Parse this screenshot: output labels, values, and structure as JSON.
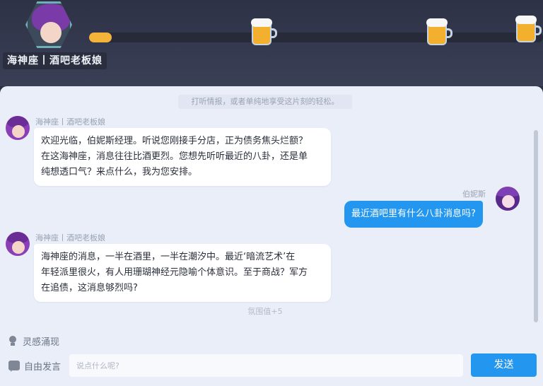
{
  "header": {
    "npc_title": "海神座丨酒吧老板娘",
    "mood_progress": 0.05,
    "beer_icons": [
      "beer-mug-icon",
      "beer-mug-icon",
      "beer-mug-icon"
    ]
  },
  "chat": {
    "hint": "打听情报，或者单纯地享受这片刻的轻松。",
    "messages": [
      {
        "sender": "海神座丨酒吧老板娘",
        "side": "left",
        "text_lines": [
          "欢迎光临，伯妮斯经理。听说您刚接手分店，正为债务焦头烂额？",
          "在这海神座，消息往往比酒更烈。您想先听听最近的八卦，还是单",
          "纯想透口气？来点什么，我为您安排。"
        ]
      },
      {
        "sender": "伯妮斯",
        "side": "right",
        "text": "最近酒吧里有什么八卦消息吗?"
      },
      {
        "sender": "海神座丨酒吧老板娘",
        "side": "left",
        "text_lines": [
          "海神座的消息，一半在酒里，一半在潮汐中。最近‘暗流艺术’在",
          "年轻派里很火，有人用珊瑚神经元隐喻个体意识。至于商战？军方",
          "在追债，这消息够烈吗?"
        ]
      }
    ],
    "atmosphere": "氛围值+5"
  },
  "bottom": {
    "inspiration_label": "灵感涌现",
    "free_talk_label": "自由发言",
    "input_placeholder": "说点什么呢?",
    "send_label": "发送"
  },
  "colors": {
    "accent": "#2396f0",
    "progress": "#f4b43a",
    "panel_bg": "#e9eef9",
    "header_bg": "#2d3246"
  }
}
